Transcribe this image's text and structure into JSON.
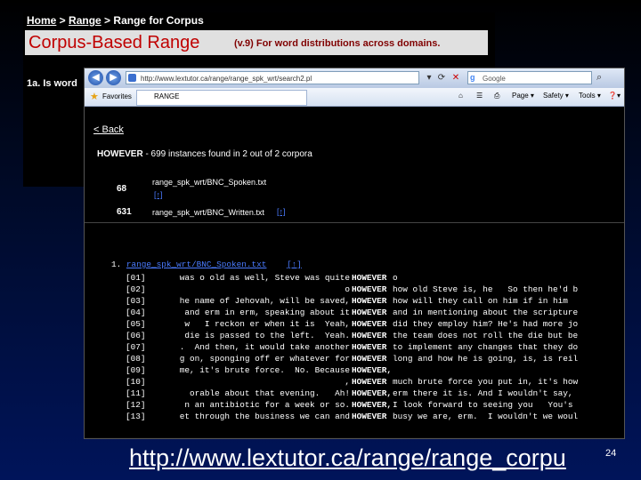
{
  "backpage": {
    "breadcrumb": {
      "home": "Home",
      "sep1": " > ",
      "range": "Range",
      "sep2": " > ",
      "current": "Range for Corpus"
    },
    "banner_title": "Corpus-Based Range",
    "banner_subtitle": "(v.9) For word distributions across domains.",
    "question": "1a. Is word"
  },
  "browser": {
    "url": "http://www.lextutor.ca/range/range_spk_wrt/search2.pl",
    "search_engine": "Google",
    "favorites_label": "Favorites",
    "tab_label": "RANGE",
    "toolbar": {
      "page": "Page ▾",
      "safety": "Safety ▾",
      "tools": "Tools ▾",
      "help": "❓▾"
    }
  },
  "content": {
    "back_link": "< Back",
    "summary_word": "HOWEVER",
    "summary_rest": " - 699 instances found in 2 out of 2 corpora",
    "corpora": [
      {
        "count": "68",
        "file": "range_spk_wrt/BNC_Spoken.txt",
        "link": "[↑]"
      },
      {
        "count": "631",
        "file": "range_spk_wrt/BNC_Written.txt",
        "link": "[↑]"
      }
    ],
    "concordance_index": "1.",
    "concordance_file": "range_spk_wrt/BNC_Spoken.txt",
    "concordance_link": "[↑]",
    "lines": [
      {
        "n": "[01]",
        "left": "was o old as well, Steve was quite",
        "kw": "HOWEVER",
        "right": "o"
      },
      {
        "n": "[02]",
        "left": "o",
        "kw": "HOWEVER",
        "right": "how old Steve is, he   So then he'd b"
      },
      {
        "n": "[03]",
        "left": "he name of Jehovah, will be saved,",
        "kw": "HOWEVER",
        "right": "how will they call on him if in him"
      },
      {
        "n": "[04]",
        "left": "and erm in erm, speaking about it",
        "kw": "HOWEVER",
        "right": "and in mentioning about the scripture"
      },
      {
        "n": "[05]",
        "left": "w   I reckon er when it is  Yeah,",
        "kw": "HOWEVER",
        "right": "did they employ him? He's had more jo"
      },
      {
        "n": "[06]",
        "left": "die is passed to the left.  Yeah.",
        "kw": "HOWEVER",
        "right": "the team does not roll the die but be"
      },
      {
        "n": "[07]",
        "left": ".  And then, it would take another",
        "kw": "HOWEVER",
        "right": "to implement any changes that they do"
      },
      {
        "n": "[08]",
        "left": "g on, sponging off er whatever for",
        "kw": "HOWEVER",
        "right": "long and how he is going, is, is reil"
      },
      {
        "n": "[09]",
        "left": "me, it's brute force.  No. Because",
        "kw": "HOWEVER,",
        "right": ""
      },
      {
        "n": "[10]",
        "left": ",",
        "kw": "HOWEVER",
        "right": "much brute force you put in, it's how"
      },
      {
        "n": "[11]",
        "left": "orable about that evening.   Ah!",
        "kw": "HOWEVER,",
        "right": "erm there it is. And I wouldn't say,"
      },
      {
        "n": "[12]",
        "left": "n an antibiotic for a week or so.",
        "kw": "HOWEVER,",
        "right": "I look forward to seeing you   You's"
      },
      {
        "n": "[13]",
        "left": "et through the business we can and",
        "kw": "HOWEVER",
        "right": "busy we are, erm.  I wouldn't we woul"
      }
    ]
  },
  "footer": {
    "url_text": "http://www.lextutor.ca/range/range_corpu",
    "page_number": "24"
  }
}
